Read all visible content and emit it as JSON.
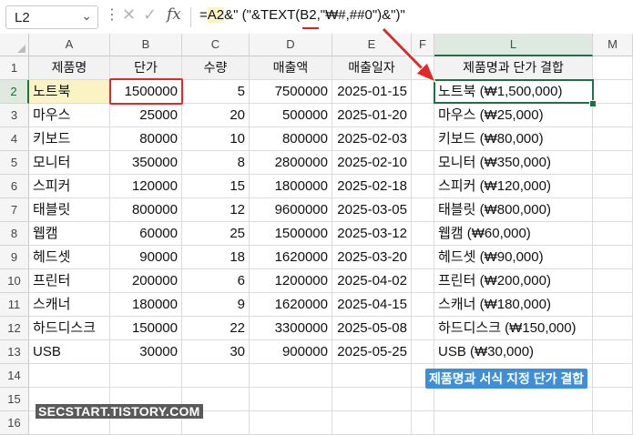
{
  "name_box": {
    "value": "L2"
  },
  "formula_bar": {
    "cancel_icon": "✕",
    "enter_icon": "✓",
    "fx_label": "fx",
    "prefix": "=",
    "ref_a2": "A2",
    "middle": "&\" (\"&TEXT(",
    "ref_b2": "B2",
    "suffix": ",\"₩#,##0\")&\")\""
  },
  "columns": [
    "A",
    "B",
    "C",
    "D",
    "E",
    "F",
    "L",
    "M"
  ],
  "rows": [
    "1",
    "2",
    "3",
    "4",
    "5",
    "6",
    "7",
    "8",
    "9",
    "10",
    "11",
    "12",
    "13",
    "14",
    "15",
    "16"
  ],
  "headers": {
    "product": "제품명",
    "unit_price": "단가",
    "quantity": "수량",
    "sales": "매출액",
    "sale_date": "매출일자",
    "combined": "제품명과 단가 결합"
  },
  "table": [
    {
      "product": "노트북",
      "price": "1500000",
      "qty": "5",
      "sales": "7500000",
      "date": "2025-01-15",
      "combined": "노트북 (₩1,500,000)"
    },
    {
      "product": "마우스",
      "price": "25000",
      "qty": "20",
      "sales": "500000",
      "date": "2025-01-20",
      "combined": "마우스 (₩25,000)"
    },
    {
      "product": "키보드",
      "price": "80000",
      "qty": "10",
      "sales": "800000",
      "date": "2025-02-03",
      "combined": "키보드 (₩80,000)"
    },
    {
      "product": "모니터",
      "price": "350000",
      "qty": "8",
      "sales": "2800000",
      "date": "2025-02-10",
      "combined": "모니터 (₩350,000)"
    },
    {
      "product": "스피커",
      "price": "120000",
      "qty": "15",
      "sales": "1800000",
      "date": "2025-02-18",
      "combined": "스피커 (₩120,000)"
    },
    {
      "product": "태블릿",
      "price": "800000",
      "qty": "12",
      "sales": "9600000",
      "date": "2025-03-05",
      "combined": "태블릿 (₩800,000)"
    },
    {
      "product": "웹캠",
      "price": "60000",
      "qty": "25",
      "sales": "1500000",
      "date": "2025-03-12",
      "combined": "웹캠 (₩60,000)"
    },
    {
      "product": "헤드셋",
      "price": "90000",
      "qty": "18",
      "sales": "1620000",
      "date": "2025-03-20",
      "combined": "헤드셋 (₩90,000)"
    },
    {
      "product": "프린터",
      "price": "200000",
      "qty": "6",
      "sales": "1200000",
      "date": "2025-04-02",
      "combined": "프린터 (₩200,000)"
    },
    {
      "product": "스캐너",
      "price": "180000",
      "qty": "9",
      "sales": "1620000",
      "date": "2025-04-15",
      "combined": "스캐너 (₩180,000)"
    },
    {
      "product": "하드디스크",
      "price": "150000",
      "qty": "22",
      "sales": "3300000",
      "date": "2025-05-08",
      "combined": "하드디스크 (₩150,000)"
    },
    {
      "product": "USB",
      "price": "30000",
      "qty": "30",
      "sales": "900000",
      "date": "2025-05-25",
      "combined": "USB (₩30,000)"
    }
  ],
  "caption": "제품명과 서식 지정 단가 결합",
  "watermark": "SECSTART.TISTORY.COM",
  "colors": {
    "selection_green": "#1e7145",
    "highlight_red": "#e02a2a",
    "a2_highlight": "#fbf3c4",
    "caption_blue": "#3f8ed8"
  }
}
